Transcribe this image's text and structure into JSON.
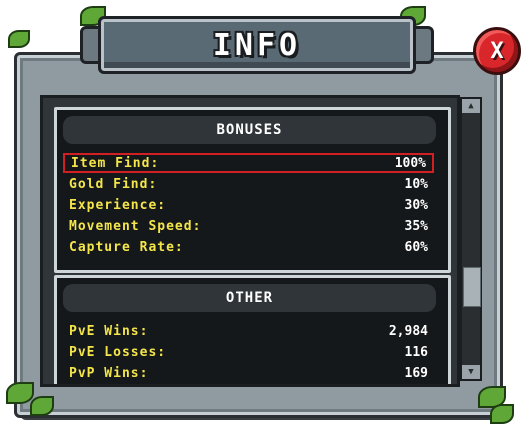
{
  "window": {
    "title": "INFO",
    "close_label": "X"
  },
  "bonuses": {
    "header": "BONUSES",
    "rows": [
      {
        "label": "Item Find:",
        "value": "100%"
      },
      {
        "label": "Gold Find:",
        "value": "10%"
      },
      {
        "label": "Experience:",
        "value": "30%"
      },
      {
        "label": "Movement Speed:",
        "value": "35%"
      },
      {
        "label": "Capture Rate:",
        "value": "60%"
      }
    ]
  },
  "other": {
    "header": "OTHER",
    "rows": [
      {
        "label": "PvE Wins:",
        "value": "2,984"
      },
      {
        "label": "PvE Losses:",
        "value": "116"
      },
      {
        "label": "PvP Wins:",
        "value": "169"
      }
    ]
  },
  "scrollbar": {
    "up_icon": "▲",
    "down_icon": "▼",
    "position": 0.6
  },
  "colors": {
    "label": "#f4e64a",
    "value": "#ffffff",
    "highlight": "#d11f24",
    "close": "#d8262a"
  }
}
